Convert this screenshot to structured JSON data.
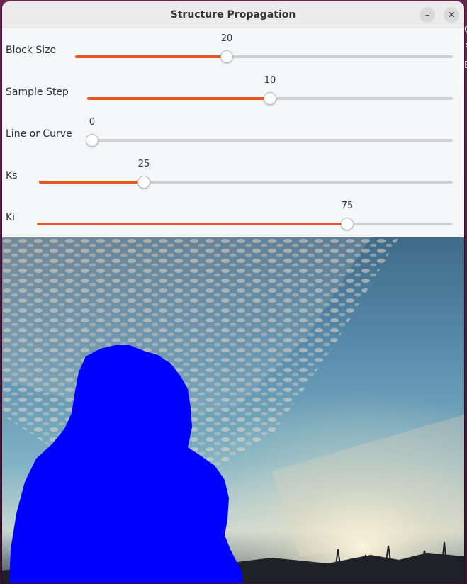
{
  "window": {
    "title": "Structure Propagation",
    "minimize_glyph": "–",
    "close_glyph": "✕"
  },
  "sliders": [
    {
      "label": "Block Size",
      "value": "20",
      "fraction": 0.4
    },
    {
      "label": "Sample Step",
      "value": "10",
      "fraction": 0.5
    },
    {
      "label": "Line or Curve",
      "value": "0",
      "fraction": 0.0
    },
    {
      "label": "Ks",
      "value": "25",
      "fraction": 0.25
    },
    {
      "label": "Ki",
      "value": "75",
      "fraction": 0.75
    }
  ],
  "image": {
    "description_icon": "sky-with-masked-region",
    "mask_color": "#0000ff"
  },
  "colors": {
    "accent": "#e95420",
    "track": "#cfcfcf"
  }
}
